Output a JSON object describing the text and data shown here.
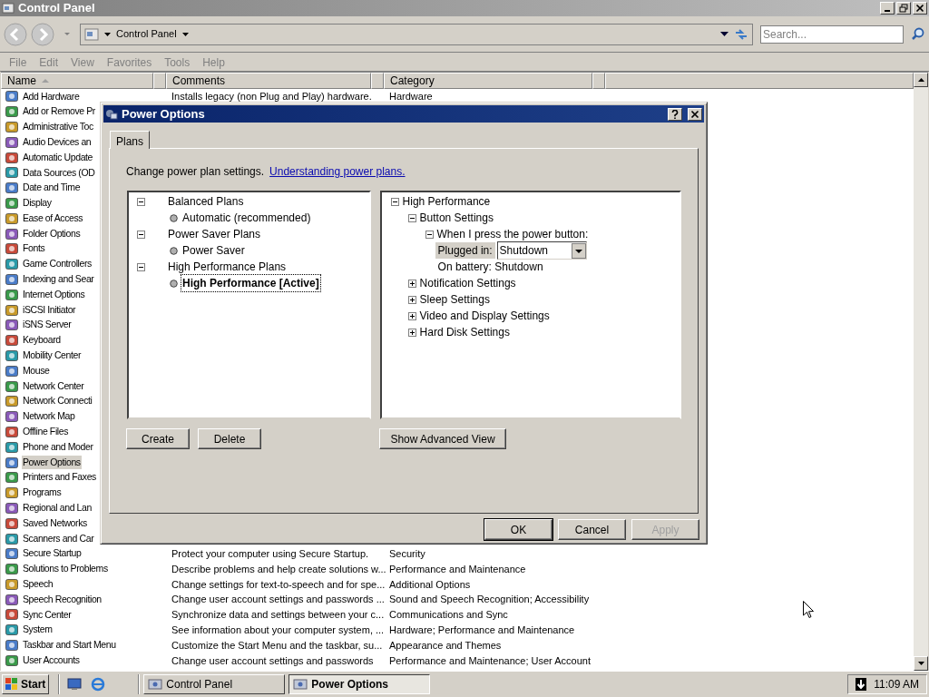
{
  "window": {
    "title": "Control Panel"
  },
  "address_bar": {
    "path": "Control Panel",
    "search_placeholder": "Search..."
  },
  "menu": [
    "File",
    "Edit",
    "View",
    "Favorites",
    "Tools",
    "Help"
  ],
  "list": {
    "columns": [
      "Name",
      "Comments",
      "Category"
    ],
    "rows": [
      {
        "name": "Add Hardware",
        "comments": "Installs legacy (non Plug and Play) hardware.",
        "category": "Hardware",
        "selected": false
      },
      {
        "name": "Add or Remove Pr",
        "selected": false
      },
      {
        "name": "Administrative Toc",
        "selected": false
      },
      {
        "name": "Audio Devices an",
        "selected": false
      },
      {
        "name": "Automatic Update",
        "selected": false
      },
      {
        "name": "Data Sources (OD",
        "selected": false
      },
      {
        "name": "Date and Time",
        "selected": false
      },
      {
        "name": "Display",
        "selected": false
      },
      {
        "name": "Ease of Access",
        "selected": false
      },
      {
        "name": "Folder Options",
        "selected": false
      },
      {
        "name": "Fonts",
        "selected": false
      },
      {
        "name": "Game Controllers",
        "selected": false
      },
      {
        "name": "Indexing and Sear",
        "selected": false
      },
      {
        "name": "Internet Options",
        "selected": false
      },
      {
        "name": "iSCSI Initiator",
        "selected": false
      },
      {
        "name": "iSNS Server",
        "selected": false
      },
      {
        "name": "Keyboard",
        "selected": false
      },
      {
        "name": "Mobility Center",
        "selected": false
      },
      {
        "name": "Mouse",
        "selected": false
      },
      {
        "name": "Network Center",
        "selected": false
      },
      {
        "name": "Network Connecti",
        "selected": false
      },
      {
        "name": "Network Map",
        "selected": false
      },
      {
        "name": "Offline Files",
        "selected": false
      },
      {
        "name": "Phone and Moder",
        "selected": false
      },
      {
        "name": "Power Options",
        "selected": true
      },
      {
        "name": "Printers and Faxes",
        "selected": false
      },
      {
        "name": "Programs",
        "selected": false
      },
      {
        "name": "Regional and Lan",
        "selected": false
      },
      {
        "name": "Saved Networks",
        "selected": false
      },
      {
        "name": "Scanners and Car",
        "selected": false
      },
      {
        "name": "Secure Startup",
        "comments": "Protect your computer using Secure Startup.",
        "category": "Security",
        "selected": false
      },
      {
        "name": "Solutions to Problems",
        "comments": "Describe problems and help create solutions w...",
        "category": "Performance and Maintenance",
        "selected": false
      },
      {
        "name": "Speech",
        "comments": "Change settings for text-to-speech and for spe...",
        "category": "Additional Options",
        "selected": false
      },
      {
        "name": "Speech Recognition",
        "comments": "Change user account settings and passwords ...",
        "category": "Sound and Speech Recognition; Accessibility",
        "selected": false
      },
      {
        "name": "Sync Center",
        "comments": "Synchronize data and settings between your c...",
        "category": "Communications and Sync",
        "selected": false
      },
      {
        "name": "System",
        "comments": "See information about your computer system, ...",
        "category": "Hardware; Performance and Maintenance",
        "selected": false
      },
      {
        "name": "Taskbar and Start Menu",
        "comments": "Customize the Start Menu and the taskbar, su...",
        "category": "Appearance and Themes",
        "selected": false
      },
      {
        "name": "User Accounts",
        "comments": "Change user account settings and passwords",
        "category": "Performance and Maintenance; User Account",
        "selected": false
      }
    ]
  },
  "dialog": {
    "title": "Power Options",
    "tabs": [
      {
        "label": "Plans",
        "selected": true
      }
    ],
    "intro": "Change power plan settings.",
    "link": "Understanding power plans.",
    "plans": [
      {
        "label": "Balanced Plans",
        "expanded": true,
        "children": [
          {
            "label": "Automatic (recommended)",
            "selected": false
          }
        ]
      },
      {
        "label": "Power Saver Plans",
        "expanded": true,
        "children": [
          {
            "label": "Power Saver",
            "selected": false
          }
        ]
      },
      {
        "label": "High Performance Plans",
        "expanded": true,
        "children": [
          {
            "label": "High Performance [Active]",
            "selected": true
          }
        ]
      }
    ],
    "settings": [
      {
        "kind": "node",
        "label": "High Performance",
        "expanded": true,
        "children": [
          {
            "kind": "node",
            "label": "Button Settings",
            "expanded": true,
            "children": [
              {
                "kind": "node",
                "label": "When I press the power button:",
                "expanded": true,
                "children": [
                  {
                    "kind": "dropdown",
                    "label": "Plugged in:",
                    "value": "Shutdown"
                  },
                  {
                    "kind": "text",
                    "label": "On battery: Shutdown"
                  }
                ]
              }
            ]
          },
          {
            "kind": "node",
            "label": "Notification Settings",
            "expanded": false
          },
          {
            "kind": "node",
            "label": "Sleep Settings",
            "expanded": false
          },
          {
            "kind": "node",
            "label": "Video and Display Settings",
            "expanded": false
          },
          {
            "kind": "node",
            "label": "Hard Disk Settings",
            "expanded": false
          }
        ]
      }
    ],
    "plan_buttons": [
      "Create",
      "Delete"
    ],
    "advanced_button": "Show Advanced View",
    "footer_buttons": [
      {
        "label": "OK",
        "disabled": false
      },
      {
        "label": "Cancel",
        "disabled": false
      },
      {
        "label": "Apply",
        "disabled": true
      }
    ]
  },
  "taskbar": {
    "start": "Start",
    "tasks": [
      {
        "label": "Control Panel",
        "selected": false
      },
      {
        "label": "Power Options",
        "selected": true
      }
    ],
    "clock": "11:09 AM"
  }
}
